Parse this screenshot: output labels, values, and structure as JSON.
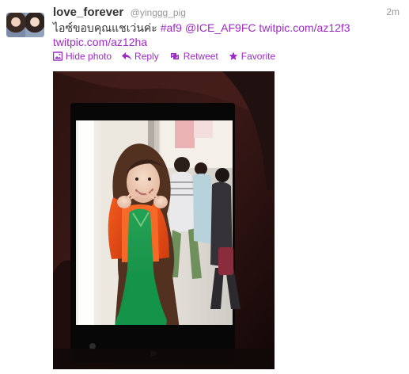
{
  "tweet": {
    "user": {
      "name": "love_forever",
      "handle": "@yinggg_pig"
    },
    "time": "2m",
    "text": {
      "thai": "ไอซ์ขอบคุณแชเว่นค่ะ",
      "hashtag": "#af9",
      "mention": "@ICE_AF9FC",
      "link1": "twitpic.com/az12f3",
      "link2": "twitpic.com/az12ha"
    },
    "actions": {
      "hide_photo": "Hide photo",
      "reply": "Reply",
      "retweet": "Retweet",
      "favorite": "Favorite"
    },
    "icons": {
      "hide_photo": "photo-icon",
      "reply": "reply-icon",
      "retweet": "retweet-icon",
      "favorite": "star-icon"
    },
    "colors": {
      "link": "#9c2bc6",
      "text": "#333333",
      "muted": "#999999"
    }
  }
}
